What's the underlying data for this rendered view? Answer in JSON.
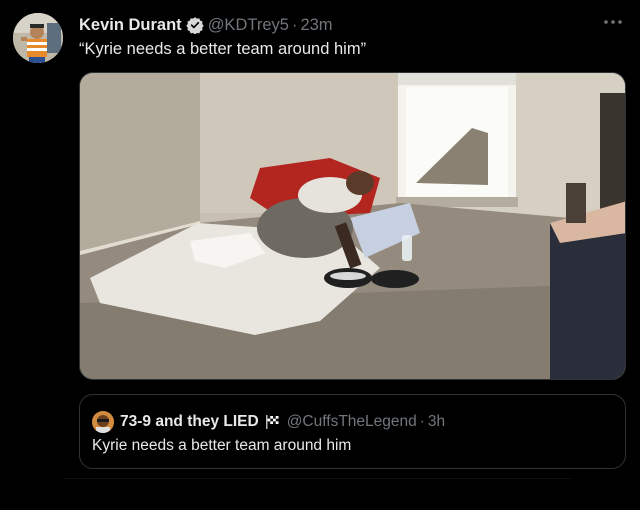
{
  "tweet": {
    "display_name": "Kevin Durant",
    "handle": "@KDTrey5",
    "separator": "·",
    "time": "23m",
    "text": "“Kyrie needs a better team around him”",
    "verified_icon": "verified-badge-icon",
    "more_icon": "more-options-icon"
  },
  "quoted": {
    "display_name": "73-9 and they LIED",
    "flag_icon": "checkered-flag-icon",
    "handle": "@CuffsTheLegend",
    "separator": "·",
    "time": "3h",
    "text": "Kyrie needs a better team around him"
  },
  "colors": {
    "background": "#000000",
    "primary_text": "#e7e9ea",
    "secondary_text": "#71767b",
    "border": "#2f3336",
    "verified": "#d9d9d9"
  }
}
